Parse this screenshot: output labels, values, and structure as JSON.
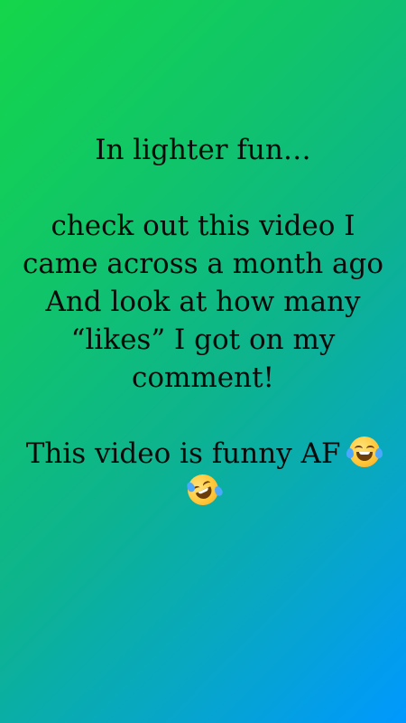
{
  "story": {
    "line1": "In lighter fun…",
    "line2": "check out this video I",
    "line3": "came across a month ago",
    "line4": "And look at how many",
    "line5": "“likes” I got on my",
    "line6": "comment!",
    "line7": "This video is funny AF",
    "emoji1": "face-with-tears-of-joy-icon",
    "emoji2": "rolling-on-the-floor-laughing-icon",
    "colors": {
      "gradient_start": "#14d64a",
      "gradient_end": "#0098ff",
      "text": "#0a0a0a"
    }
  }
}
